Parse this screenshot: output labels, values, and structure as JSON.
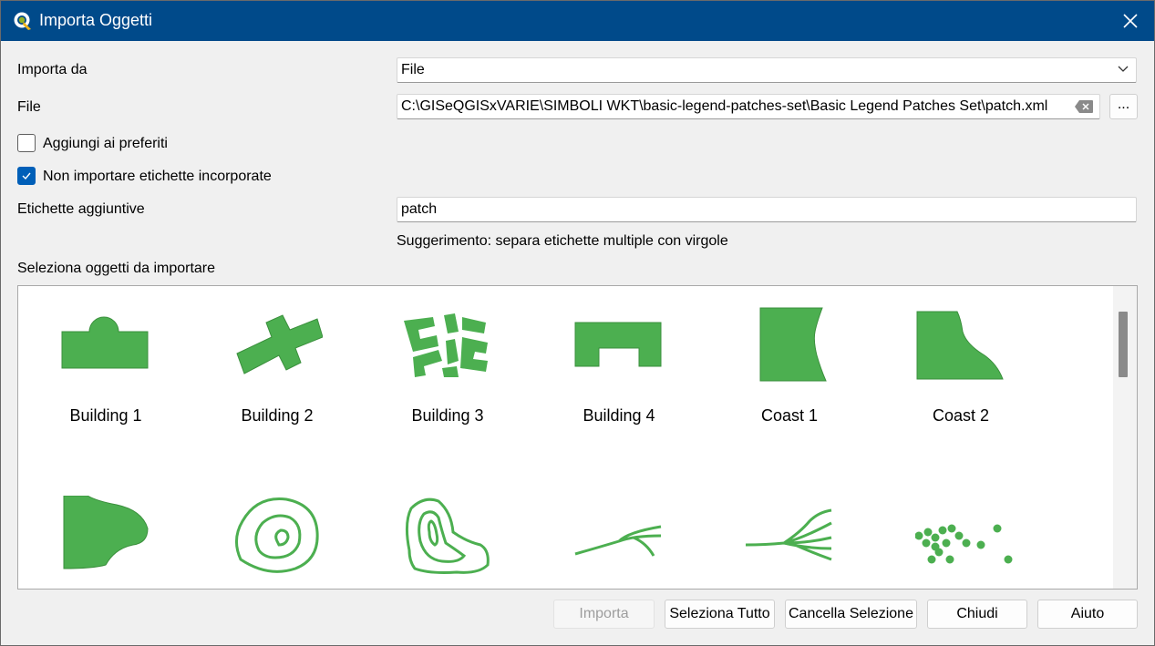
{
  "window": {
    "title": "Importa Oggetti"
  },
  "form": {
    "import_from_label": "Importa da",
    "import_from_value": "File",
    "file_label": "File",
    "file_value": "C:\\GISeQGISxVARIE\\SIMBOLI WKT\\basic-legend-patches-set\\Basic Legend Patches Set\\patch.xml",
    "browse_label": "...",
    "add_favorites_label": "Aggiungi ai preferiti",
    "add_favorites_checked": false,
    "no_embedded_tags_label": "Non importare etichette incorporate",
    "no_embedded_tags_checked": true,
    "extra_tags_label": "Etichette aggiuntive",
    "extra_tags_value": "patch",
    "hint": "Suggerimento: separa etichette multiple con virgole",
    "select_label": "Seleziona oggetti da importare"
  },
  "items": [
    {
      "name": "Building 1",
      "icon": "building-1-icon"
    },
    {
      "name": "Building 2",
      "icon": "building-2-icon"
    },
    {
      "name": "Building 3",
      "icon": "building-3-icon"
    },
    {
      "name": "Building 4",
      "icon": "building-4-icon"
    },
    {
      "name": "Coast 1",
      "icon": "coast-1-icon"
    },
    {
      "name": "Coast 2",
      "icon": "coast-2-icon"
    },
    {
      "name": "",
      "icon": "coast-shape-icon"
    },
    {
      "name": "",
      "icon": "contour-1-icon"
    },
    {
      "name": "",
      "icon": "contour-2-icon"
    },
    {
      "name": "",
      "icon": "river-1-icon"
    },
    {
      "name": "",
      "icon": "river-2-icon"
    },
    {
      "name": "",
      "icon": "points-icon"
    }
  ],
  "buttons": {
    "import": "Importa",
    "select_all": "Seleziona Tutto",
    "clear_selection": "Cancella Selezione",
    "close": "Chiudi",
    "help": "Aiuto"
  },
  "colors": {
    "titlebar": "#004a8a",
    "symbol_fill": "#4caf50",
    "symbol_stroke": "#3a8f3c",
    "checkbox_checked": "#005fb8"
  }
}
